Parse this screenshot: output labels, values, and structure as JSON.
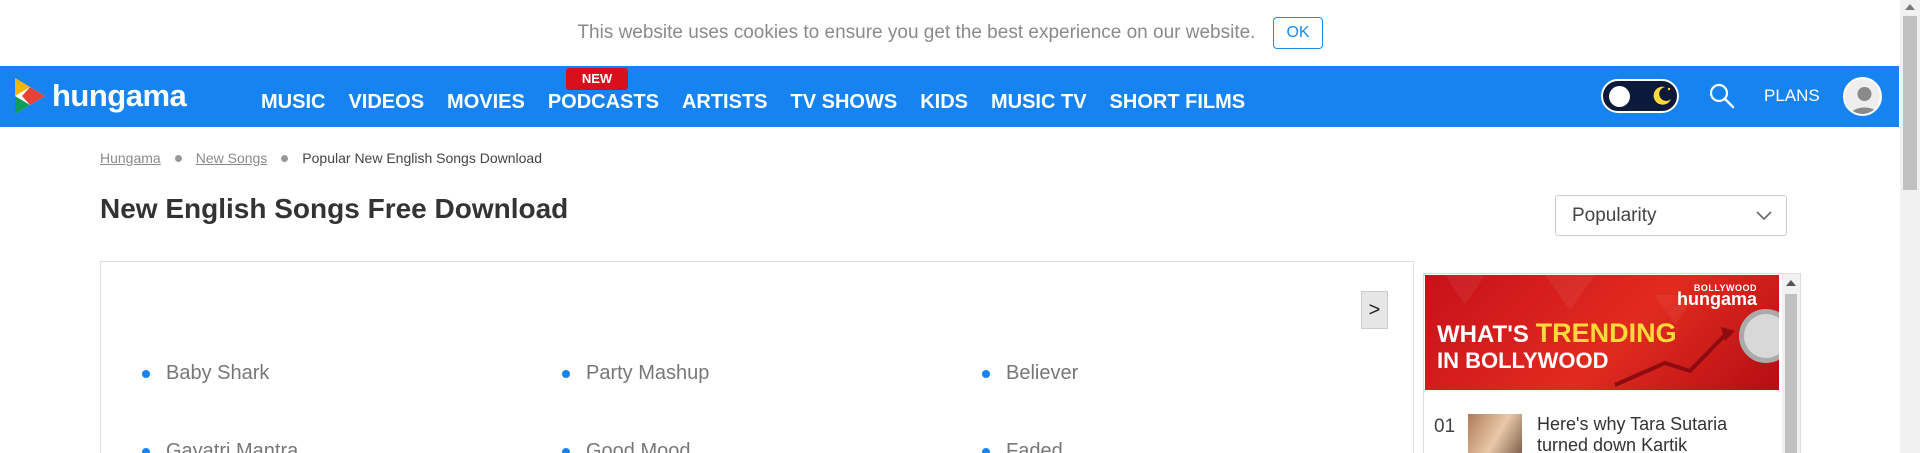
{
  "cookie_bar": {
    "message": "This website uses cookies to ensure you get the best experience on our website.",
    "ok_label": "OK"
  },
  "header": {
    "logo_text": "hungama",
    "menu": [
      {
        "label": "MUSIC"
      },
      {
        "label": "VIDEOS"
      },
      {
        "label": "MOVIES"
      },
      {
        "label": "PODCASTS",
        "badge": "NEW"
      },
      {
        "label": "ARTISTS"
      },
      {
        "label": "TV SHOWS"
      },
      {
        "label": "KIDS"
      },
      {
        "label": "MUSIC TV"
      },
      {
        "label": "SHORT FILMS"
      }
    ],
    "plans_label": "PLANS",
    "theme_toggle": {
      "state": "off",
      "icon": "moon-icon"
    },
    "search_icon": "search-icon",
    "avatar_icon": "user-avatar-icon"
  },
  "breadcrumb": {
    "items": [
      "Hungama",
      "New Songs"
    ],
    "current": "Popular New English Songs Download"
  },
  "page_title": "New English Songs Free Download",
  "sort": {
    "selected": "Popularity"
  },
  "content": {
    "next_label": ">",
    "songs": [
      "Baby Shark",
      "Party Mashup",
      "Believer",
      "Gayatri Mantra",
      "Good Mood",
      "Faded"
    ]
  },
  "widget": {
    "banner": {
      "brand_small": "BOLLYWOOD",
      "brand": "hungama",
      "line1_prefix": "WHAT'S ",
      "line1_highlight": "TRENDING",
      "line2": "IN BOLLYWOOD"
    },
    "items": [
      {
        "number": "01",
        "title": "Here's why Tara Sutaria turned down Kartik"
      }
    ]
  },
  "colors": {
    "nav_blue": "#1683f0",
    "badge_red": "#d8101e",
    "banner_red": "#d11a1e",
    "highlight_yellow": "#ffd93a"
  }
}
